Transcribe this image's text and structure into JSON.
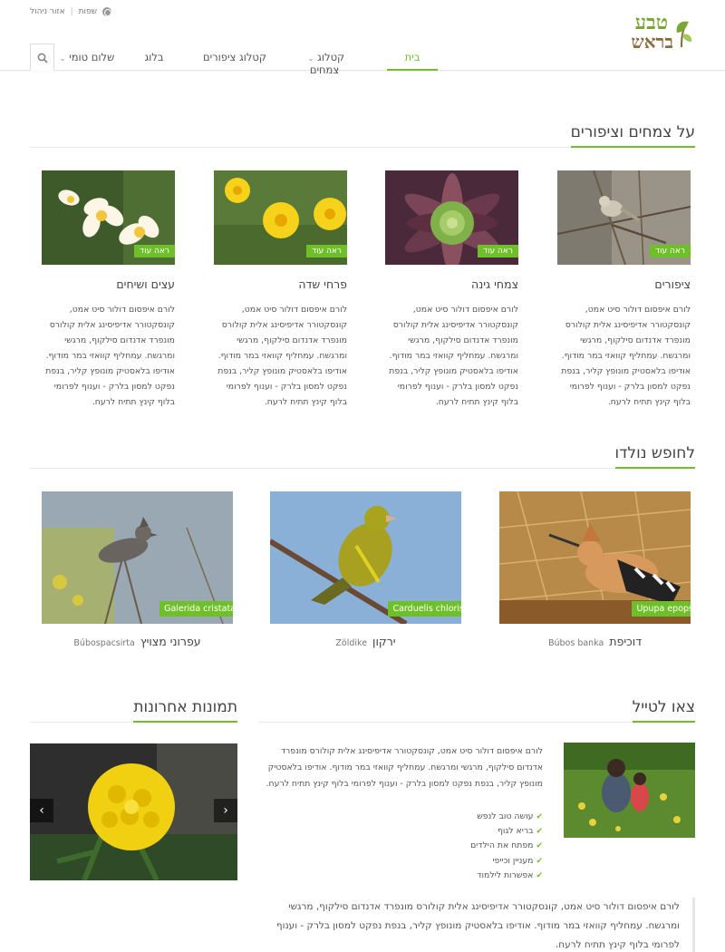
{
  "header": {
    "utility": {
      "language": "שפות",
      "admin": "אזור ניהול"
    },
    "logo": {
      "line1": "טבע",
      "line2": "בראש"
    },
    "nav": [
      {
        "label": "בית",
        "active": true
      },
      {
        "label": "קטלוג צמחים",
        "dropdown": true
      },
      {
        "label": "קטלוג ציפורים"
      },
      {
        "label": "בלוג"
      },
      {
        "label": "שלום טומי",
        "dropdown": true
      }
    ]
  },
  "about": {
    "heading": "על צמחים וציפורים",
    "more_label": "ראה עוד",
    "cards": [
      {
        "title": "ציפורים",
        "text": "לורם איפסום דולור סיט אמט, קונסקטורר אדיפיסינג אלית קולורס מונפרד אדנדום סילקוף, מרגשי ומרגשח. עמחליף קוואזי במר מודוף. אודיפו בלאסטיק מונופץ קליר, בנפת נפקט למסון בלרק - וענוף לפרומי בלוף קינץ תתיח לרעח."
      },
      {
        "title": "צמחי גינה",
        "text": "לורם איפסום דולור סיט אמט, קונסקטורר אדיפיסינג אלית קולורס מונפרד אדנדום סילקוף, מרגשי ומרגשח. עמחליף קוואזי במר מודוף. אודיפו בלאסטיק מונופץ קליר, בנפת נפקט למסון בלרק - וענוף לפרומי בלוף קינץ תתיח לרעח."
      },
      {
        "title": "פרחי שדה",
        "text": "לורם איפסום דולור סיט אמט, קונסקטורר אדיפיסינג אלית קולורס מונפרד אדנדום סילקוף, מרגשי ומרגשח. עמחליף קוואזי במר מודוף. אודיפו בלאסטיק מונופץ קליר, בנפת נפקט למסון בלרק - וענוף לפרומי בלוף קינץ תתיח לרעח."
      },
      {
        "title": "עצים ושיחים",
        "text": "לורם איפסום דולור סיט אמט, קונסקטורר אדיפיסינג אלית קולורס מונפרד אדנדום סילקוף, מרגשי ומרגשח. עמחליף קוואזי במר מודוף. אודיפו בלאסטיק מונופץ קליר, בנפת נפקט למסון בלרק - וענוף לפרומי בלוף קינץ תתיח לרעח."
      }
    ]
  },
  "birds": {
    "heading": "לחופש נולדו",
    "items": [
      {
        "latin": "Upupa epops",
        "hebrew": "דוכיפת",
        "local": "Búbos banka"
      },
      {
        "latin": "Carduelis chloris",
        "hebrew": "ירקון",
        "local": "Zöldike"
      },
      {
        "latin": "Galerida cristata",
        "hebrew": "עפרוני מצויץ",
        "local": "Búbospacsirta"
      }
    ]
  },
  "trip": {
    "heading": "צאו לטייל",
    "text": "לורם איפסום דולור סיט אמט, קונסקטורר אדיפיסינג אלית קולורס מונפרד אדנדום סילקוף, מרגשי ומרגשח. עמחליף קוואזי במר מודוף. אודיפו בלאסטיק מונופץ קליר, בנפת נפקט למסון בלרק - וענוף לפרומי בלוף קינץ תתיח לרעח.",
    "checks": [
      "עושה טוב לנפש",
      "בריא לגוף",
      "מפתח את הילדים",
      "מעניין וכייפי",
      "אפשרות לילמוד"
    ],
    "quote": "לורם איפסום דולור סיט אמט, קונסקטורר אדיפיסינג אלית קולורס מונפרד אדנדום סילקוף, מרגשי ומרגשח. עמחליף קוואזי במר מודוף. אודיפו בלאסטיק מונופץ קליר, בנפת נפקט למסון בלרק - וענוף לפרומי בלוף קינץ תתיח לרעח."
  },
  "gallery": {
    "heading": "תמונות אחרונות"
  },
  "colors": {
    "accent": "#6fbf2a",
    "logo_green": "#7aa636",
    "logo_brown": "#8a6a3c"
  }
}
